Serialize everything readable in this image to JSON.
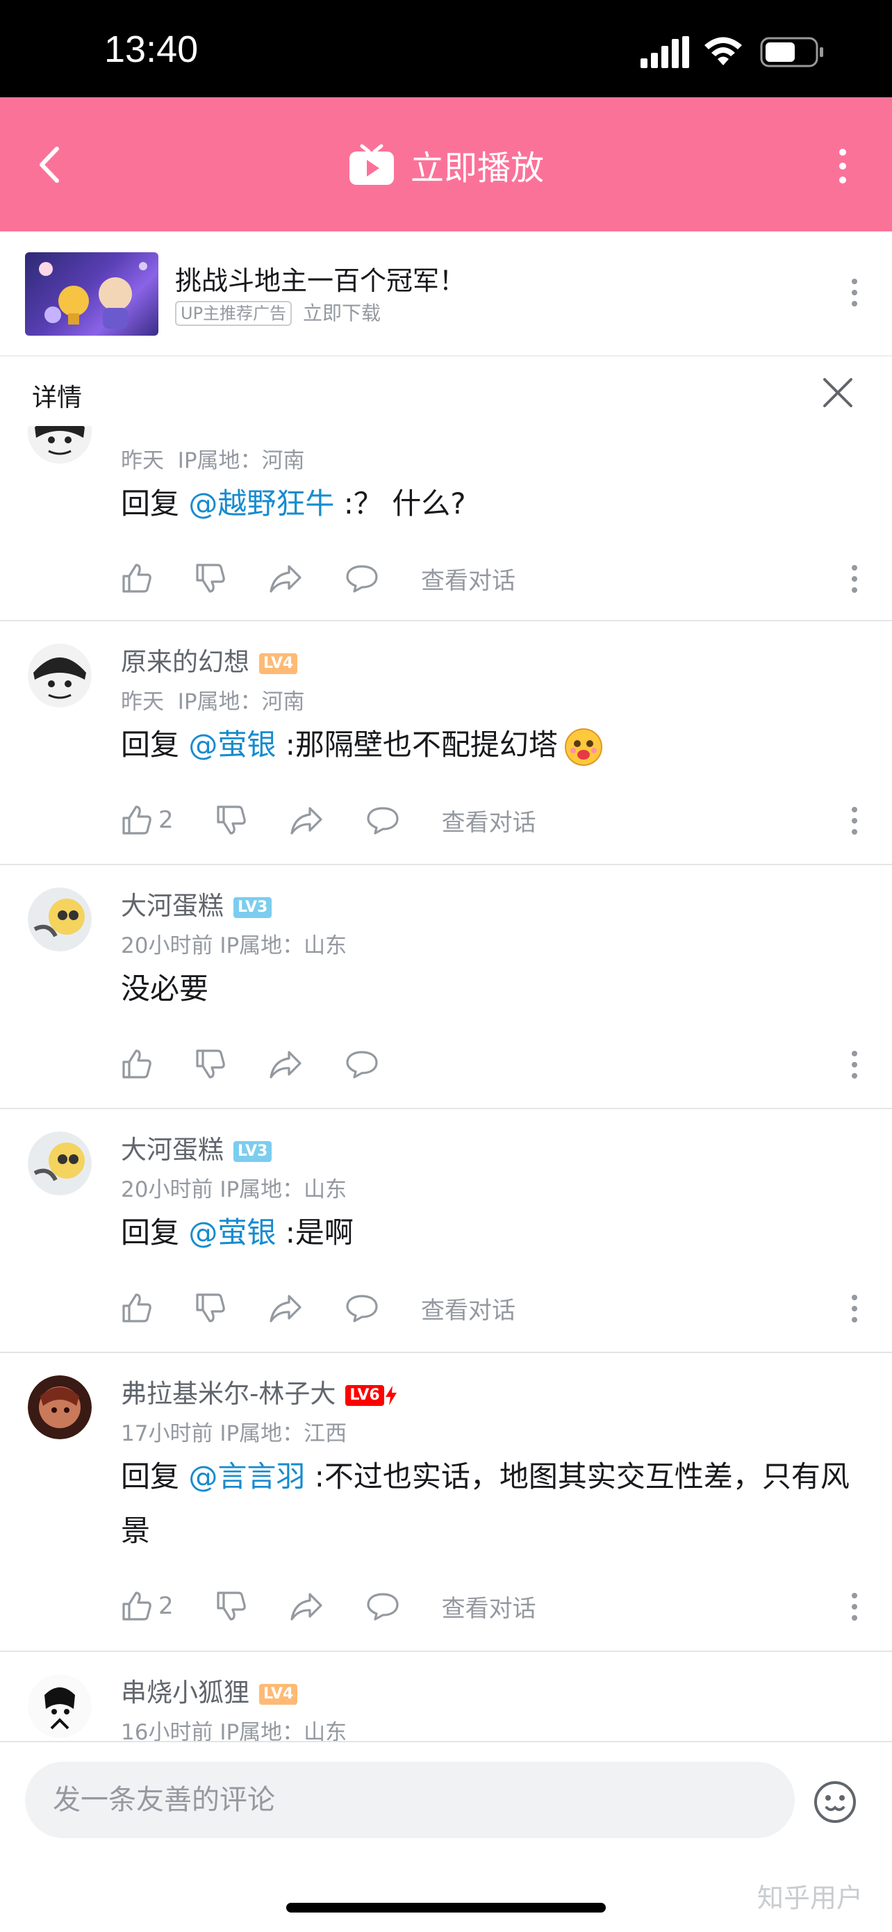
{
  "status_bar": {
    "time": "13:40"
  },
  "top_bar": {
    "title": "立即播放"
  },
  "ad": {
    "title": "挑战斗地主一百个冠军！",
    "badge": "UP主推荐广告",
    "download": "立即下载"
  },
  "detail": {
    "label": "详情"
  },
  "comments": [
    {
      "username": "",
      "level": "",
      "time": "昨天",
      "ip": "IP属地：河南",
      "reply_prefix": "回复 ",
      "mention": "@越野狂牛",
      "text": " :？ 什么?",
      "likes": "",
      "view_dialog": "查看对话"
    },
    {
      "username": "原来的幻想",
      "level": "LV4",
      "time": "昨天",
      "ip": "IP属地：河南",
      "reply_prefix": "回复 ",
      "mention": "@萤银",
      "text": " :那隔壁也不配提幻塔",
      "likes": "2",
      "view_dialog": "查看对话"
    },
    {
      "username": "大河蛋糕",
      "level": "LV3",
      "time": "20小时前",
      "ip": "IP属地：山东",
      "reply_prefix": "",
      "mention": "",
      "text": "没必要",
      "likes": "",
      "view_dialog": ""
    },
    {
      "username": "大河蛋糕",
      "level": "LV3",
      "time": "20小时前",
      "ip": "IP属地：山东",
      "reply_prefix": "回复 ",
      "mention": "@萤银",
      "text": " :是啊",
      "likes": "",
      "view_dialog": "查看对话"
    },
    {
      "username": "弗拉基米尔-林子大",
      "level": "LV6",
      "time": "17小时前",
      "ip": "IP属地：江西",
      "reply_prefix": "回复 ",
      "mention": "@言言羽",
      "text": " :不过也实话，地图其实交互性差，只有风景",
      "likes": "2",
      "view_dialog": "查看对话"
    },
    {
      "username": "串烧小狐狸",
      "level": "LV4",
      "time": "16小时前",
      "ip": "IP属地：山东",
      "reply_prefix": "",
      "mention": "",
      "text": "",
      "likes": "",
      "view_dialog": ""
    }
  ],
  "input": {
    "placeholder": "发一条友善的评论"
  },
  "watermark": "知乎用户",
  "colors": {
    "accent": "#fb7299",
    "mention": "#178bcf",
    "lv3": "#7bcdef",
    "lv4": "#feba75",
    "lv6": "#ff0000"
  }
}
